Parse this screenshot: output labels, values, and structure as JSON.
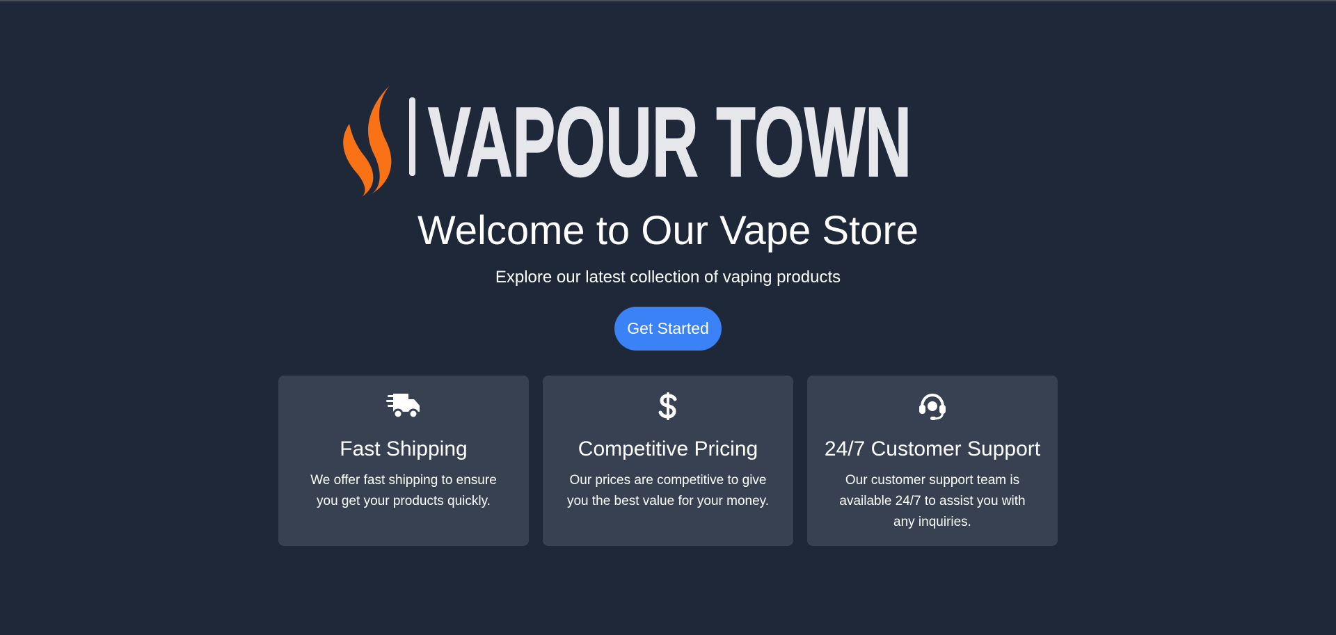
{
  "logo": {
    "text": "VAPOUR TOWN",
    "flame_color": "#f97316",
    "text_fill": "#e5e7eb"
  },
  "hero": {
    "title": "Welcome to Our Vape Store",
    "subtitle": "Explore our latest collection of vaping products",
    "cta_label": "Get Started"
  },
  "features": [
    {
      "icon": "truck-fast-icon",
      "title": "Fast Shipping",
      "description": "We offer fast shipping to ensure you get your products quickly."
    },
    {
      "icon": "dollar-icon",
      "title": "Competitive Pricing",
      "description": "Our prices are competitive to give you the best value for your money."
    },
    {
      "icon": "headset-icon",
      "title": "24/7 Customer Support",
      "description": "Our customer support team is available 24/7 to assist you with any inquiries."
    }
  ],
  "colors": {
    "background": "#1f2838",
    "card": "#374151",
    "accent": "#3b82f6"
  }
}
